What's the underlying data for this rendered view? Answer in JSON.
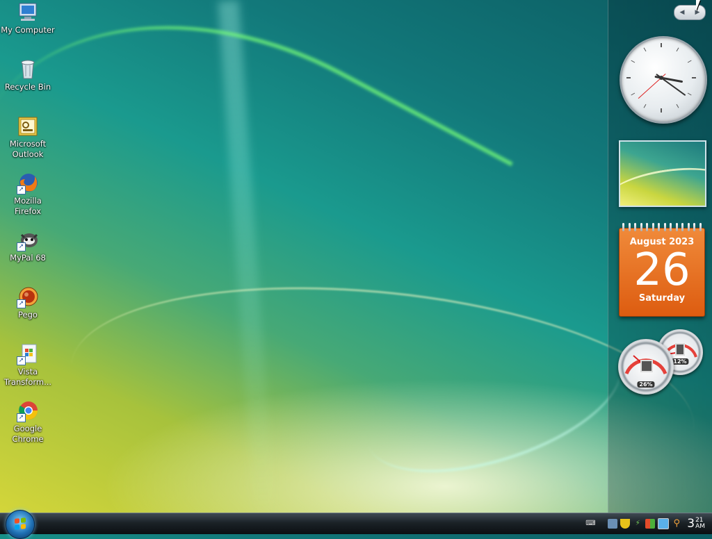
{
  "desktop": {
    "icons": [
      {
        "label": "My Computer",
        "icon": "computer-icon"
      },
      {
        "label": "Recycle Bin",
        "icon": "recycle-bin-icon"
      },
      {
        "label": "Microsoft Outlook",
        "icon": "outlook-icon"
      },
      {
        "label": "Mozilla Firefox",
        "icon": "firefox-icon"
      },
      {
        "label": "MyPal 68",
        "icon": "mypal-icon"
      },
      {
        "label": "Pego",
        "icon": "pego-icon"
      },
      {
        "label": "Vista Transform...",
        "icon": "vista-transform-icon"
      },
      {
        "label": "Google Chrome",
        "icon": "chrome-icon"
      }
    ]
  },
  "sidebar": {
    "clock_gadget": {
      "hour": 3,
      "minute": 21,
      "second": 38
    },
    "calendar_gadget": {
      "month_year": "August 2023",
      "day": "26",
      "weekday": "Saturday"
    },
    "cpu_meter": {
      "cpu_percent": "26%",
      "memory_percent": "12%"
    }
  },
  "taskbar": {
    "clock": {
      "hour": "3",
      "minute": "21",
      "ampm": "AM"
    },
    "tray_icons": [
      "keyboard-icon",
      "network-icon",
      "security-icon",
      "power-icon",
      "windows-flag-icon",
      "display-icon",
      "search-icon"
    ]
  },
  "colors": {
    "accent": "#1f6fb3",
    "calendar": "#e4661d"
  }
}
